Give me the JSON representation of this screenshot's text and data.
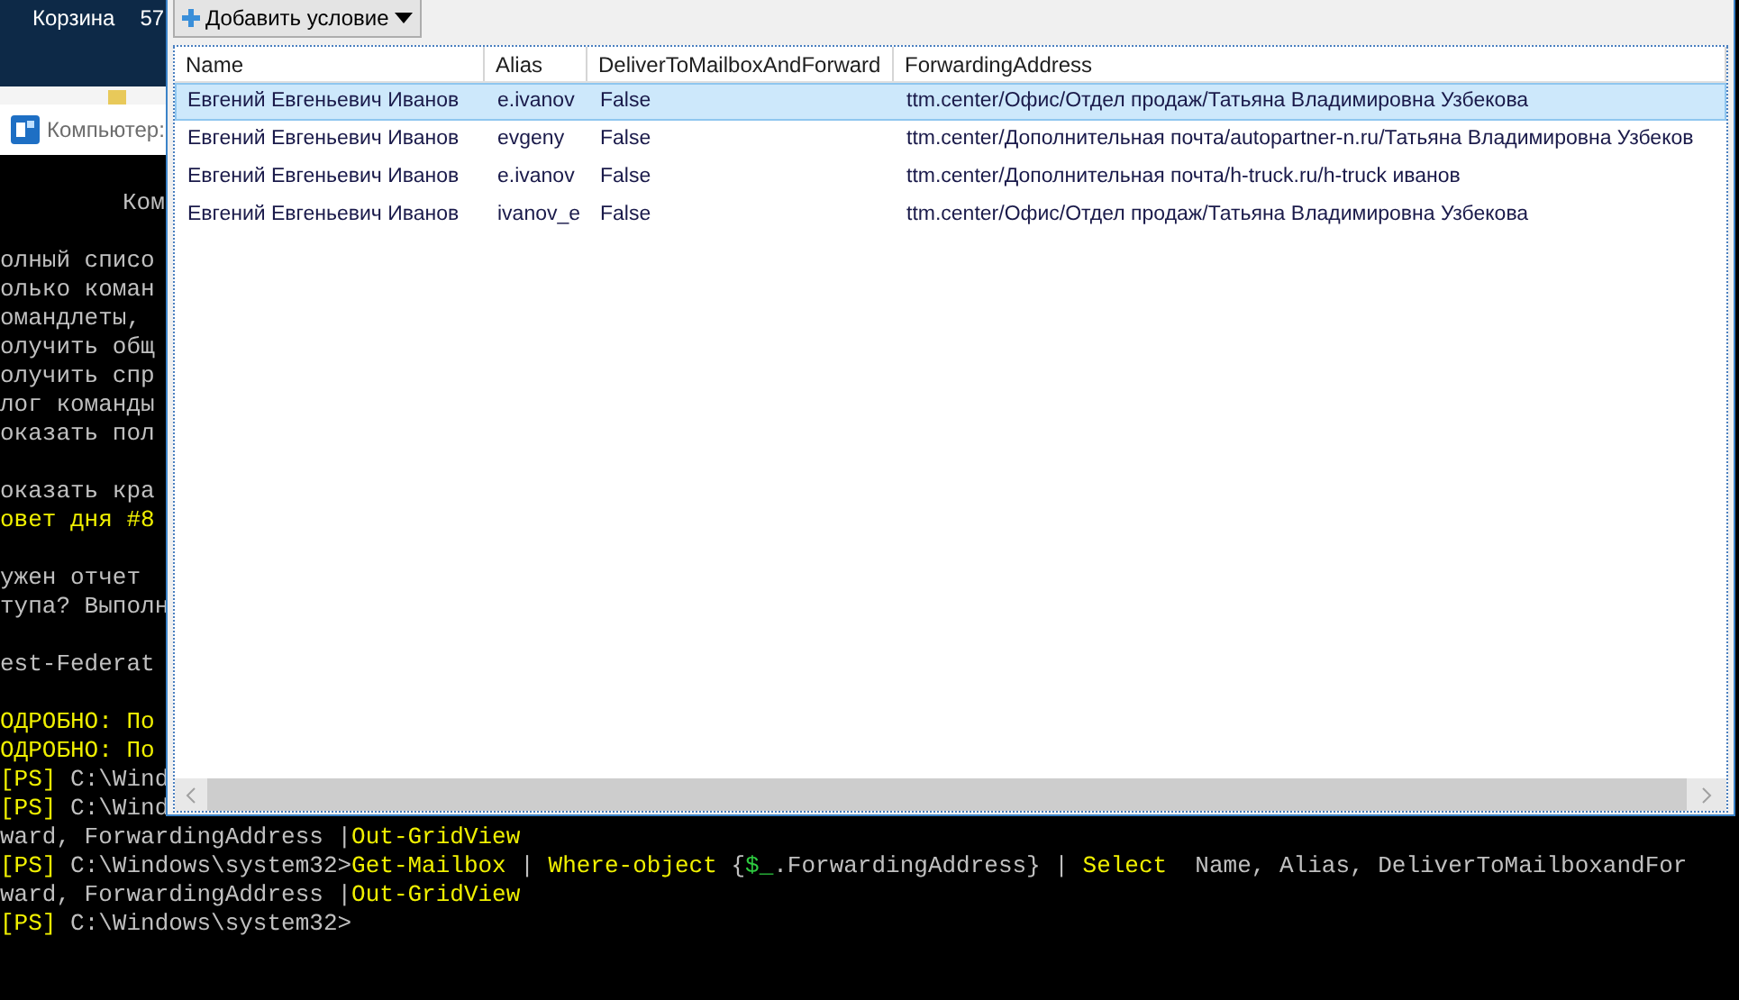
{
  "desktop": {
    "icon_label": "Корзина",
    "icon_label_2": "57"
  },
  "background_window": {
    "title": "Компьютер:"
  },
  "console": {
    "lines": [
      {
        "kind": "title",
        "segments": [
          {
            "text": "Ком",
            "color": "#c0c0c0"
          }
        ]
      },
      {
        "kind": "blank"
      },
      {
        "kind": "text",
        "segments": [
          {
            "text": "олный списо",
            "color": "#c0c0c0"
          }
        ]
      },
      {
        "kind": "text",
        "segments": [
          {
            "text": "олько коман",
            "color": "#c0c0c0"
          }
        ]
      },
      {
        "kind": "text",
        "segments": [
          {
            "text": "омандлеты,",
            "color": "#c0c0c0"
          }
        ]
      },
      {
        "kind": "text",
        "segments": [
          {
            "text": "олучить общ",
            "color": "#c0c0c0"
          }
        ]
      },
      {
        "kind": "text",
        "segments": [
          {
            "text": "олучить спр",
            "color": "#c0c0c0"
          }
        ]
      },
      {
        "kind": "text",
        "segments": [
          {
            "text": "лог команды",
            "color": "#c0c0c0"
          }
        ]
      },
      {
        "kind": "text",
        "segments": [
          {
            "text": "оказать пол",
            "color": "#c0c0c0"
          }
        ]
      },
      {
        "kind": "blank"
      },
      {
        "kind": "text",
        "segments": [
          {
            "text": "оказать кра",
            "color": "#c0c0c0"
          }
        ]
      },
      {
        "kind": "text",
        "segments": [
          {
            "text": "овет дня #8",
            "color": "#f0f000"
          }
        ]
      },
      {
        "kind": "blank"
      },
      {
        "kind": "text",
        "segments": [
          {
            "text": "ужен отчет",
            "color": "#c0c0c0"
          }
        ]
      },
      {
        "kind": "text",
        "segments": [
          {
            "text": "тупа? Выполн",
            "color": "#c0c0c0"
          }
        ]
      },
      {
        "kind": "blank"
      },
      {
        "kind": "text",
        "segments": [
          {
            "text": "est-Federat",
            "color": "#c0c0c0"
          }
        ]
      },
      {
        "kind": "blank"
      },
      {
        "kind": "text",
        "segments": [
          {
            "text": "ОДРОБНО: По",
            "color": "#f0f000"
          }
        ]
      },
      {
        "kind": "text",
        "segments": [
          {
            "text": "ОДРОБНО: По",
            "color": "#f0f000"
          }
        ]
      },
      {
        "kind": "text",
        "segments": [
          {
            "text": "[PS] ",
            "color": "#f0f000"
          },
          {
            "text": "C:\\Wind",
            "color": "#c0c0c0"
          }
        ]
      },
      {
        "kind": "text",
        "segments": [
          {
            "text": "[PS] ",
            "color": "#f0f000"
          },
          {
            "text": "C:\\Wind",
            "color": "#c0c0c0"
          }
        ]
      },
      {
        "kind": "text",
        "segments": [
          {
            "text": "ward, ForwardingAddress |",
            "color": "#c0c0c0"
          },
          {
            "text": "Out-GridView",
            "color": "#f0f000"
          }
        ]
      },
      {
        "kind": "text",
        "segments": [
          {
            "text": "[PS] ",
            "color": "#f0f000"
          },
          {
            "text": "C:\\Windows\\system32>",
            "color": "#c0c0c0"
          },
          {
            "text": "Get-Mailbox",
            "color": "#f0f000"
          },
          {
            "text": " | ",
            "color": "#c0c0c0"
          },
          {
            "text": "Where-object",
            "color": "#f0f000"
          },
          {
            "text": " {",
            "color": "#c0c0c0"
          },
          {
            "text": "$_",
            "color": "#2ecc40"
          },
          {
            "text": ".ForwardingAddress} | ",
            "color": "#c0c0c0"
          },
          {
            "text": "Select",
            "color": "#f0f000"
          },
          {
            "text": "  Name, Alias, DeliverToMailboxandFor",
            "color": "#c0c0c0"
          }
        ]
      },
      {
        "kind": "text",
        "segments": [
          {
            "text": "ward, ForwardingAddress |",
            "color": "#c0c0c0"
          },
          {
            "text": "Out-GridView",
            "color": "#f0f000"
          }
        ]
      },
      {
        "kind": "text",
        "segments": [
          {
            "text": "[PS] ",
            "color": "#f0f000"
          },
          {
            "text": "C:\\Windows\\system32>",
            "color": "#c0c0c0"
          }
        ]
      }
    ]
  },
  "grid_window": {
    "add_condition_button": "Добавить условие",
    "table": {
      "columns": [
        {
          "label": "Name"
        },
        {
          "label": "Alias"
        },
        {
          "label": "DeliverToMailboxAndForward"
        },
        {
          "label": "ForwardingAddress"
        }
      ],
      "rows": [
        {
          "selected": true,
          "cells": [
            "Евгений Евгеньевич Иванов",
            "e.ivanov",
            "False",
            "ttm.center/Офис/Отдел продаж/Татьяна Владимировна Узбекова"
          ]
        },
        {
          "selected": false,
          "cells": [
            "Евгений Евгеньевич Иванов",
            "evgeny",
            "False",
            "ttm.center/Дополнительная почта/autopartner-n.ru/Татьяна Владимировна Узбеков"
          ]
        },
        {
          "selected": false,
          "cells": [
            "Евгений Евгеньевич Иванов",
            "e.ivanov",
            "False",
            "ttm.center/Дополнительная почта/h-truck.ru/h-truck иванов"
          ]
        },
        {
          "selected": false,
          "cells": [
            "Евгений Евгеньевич Иванов",
            "ivanov_e",
            "False",
            "ttm.center/Офис/Отдел продаж/Татьяна Владимировна Узбекова"
          ]
        }
      ]
    }
  }
}
